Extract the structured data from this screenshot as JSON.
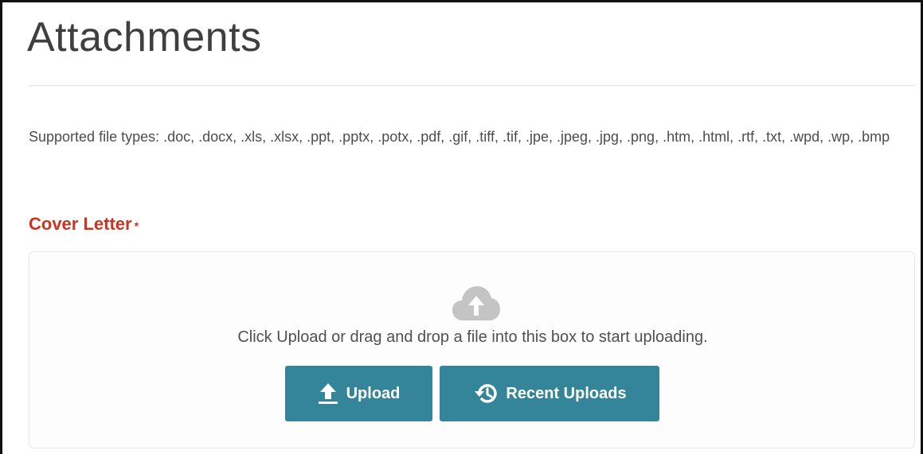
{
  "page": {
    "title": "Attachments",
    "supported_types_text": "Supported file types: .doc, .docx, .xls, .xlsx, .ppt, .pptx, .potx, .pdf, .gif, .tiff, .tif, .jpe, .jpeg, .jpg, .png, .htm, .html, .rtf, .txt, .wpd, .wp, .bmp"
  },
  "cover_letter": {
    "label": "Cover Letter",
    "required_marker": "*",
    "dropzone": {
      "icon": "cloud-upload-icon",
      "instructions": "Click Upload or drag and drop a file into this box to start uploading."
    },
    "buttons": {
      "upload_label": "Upload",
      "upload_icon": "upload-arrow-icon",
      "recent_label": "Recent Uploads",
      "recent_icon": "history-icon"
    }
  },
  "colors": {
    "label_required": "#c9361f",
    "button_bg": "#34849a",
    "cloud_icon": "#c4c4c4"
  }
}
